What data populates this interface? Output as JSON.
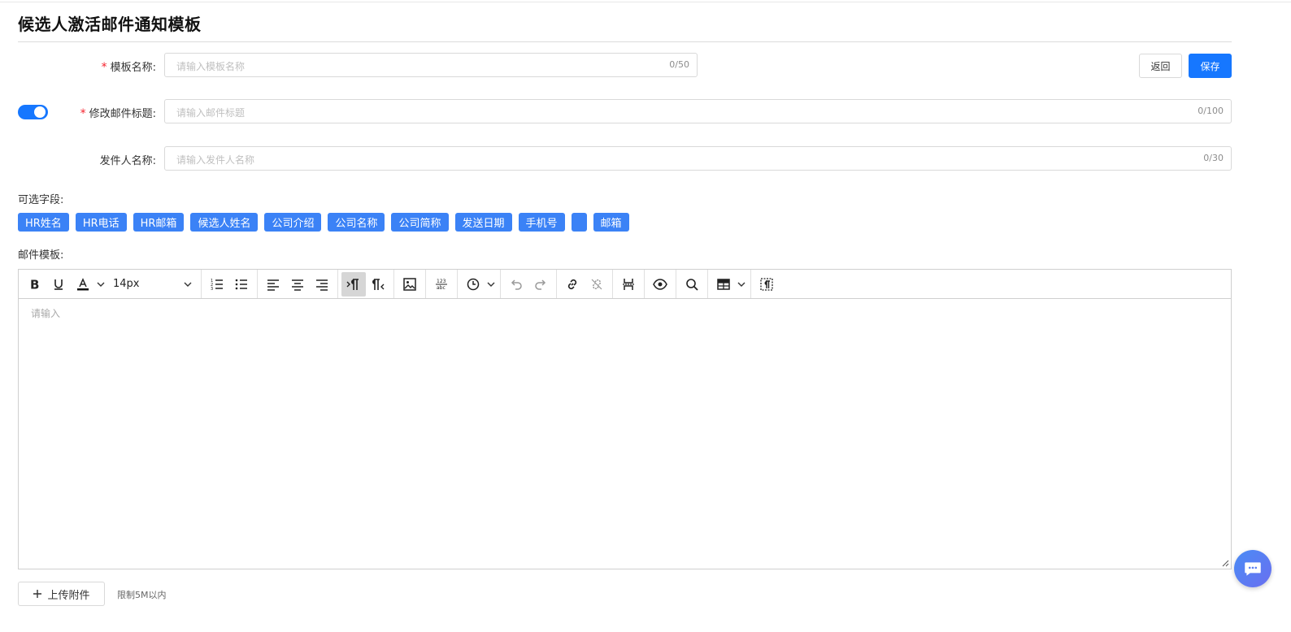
{
  "page": {
    "title": "候选人激活邮件通知模板"
  },
  "form": {
    "template_name": {
      "label": "模板名称:",
      "placeholder": "请输入模板名称",
      "count": "0/50",
      "required": true
    },
    "mail_subject": {
      "label": "修改邮件标题:",
      "placeholder": "请输入邮件标题",
      "count": "0/100",
      "required": true,
      "toggle_on": true
    },
    "sender_name": {
      "label": "发件人名称:",
      "placeholder": "请输入发件人名称",
      "count": "0/30",
      "required": false
    }
  },
  "actions": {
    "back_label": "返回",
    "save_label": "保存"
  },
  "fields": {
    "label": "可选字段:",
    "tags": [
      "HR姓名",
      "HR电话",
      "HR邮箱",
      "候选人姓名",
      "公司介绍",
      "公司名称",
      "公司简称",
      "发送日期",
      "手机号",
      "",
      "邮箱"
    ]
  },
  "editor": {
    "label": "邮件模板:",
    "font_size": "14px",
    "placeholder": "请输入",
    "toolbar_icons": [
      "bold-icon",
      "underline-icon",
      "font-color-icon",
      "ordered-list-icon",
      "bullet-list-icon",
      "align-left-icon",
      "align-center-icon",
      "align-right-icon",
      "ltr-icon",
      "rtl-icon",
      "image-icon",
      "spellcheck-icon",
      "clock-icon",
      "undo-icon",
      "redo-icon",
      "link-icon",
      "unlink-icon",
      "page-break-icon",
      "preview-icon",
      "search-icon",
      "table-icon",
      "show-blocks-icon"
    ]
  },
  "attachment": {
    "upload_label": "上传附件",
    "limit_text": "限制5M以内"
  },
  "colors": {
    "primary": "#1677ff",
    "tag": "#3b82f6",
    "required": "#f5222d"
  }
}
